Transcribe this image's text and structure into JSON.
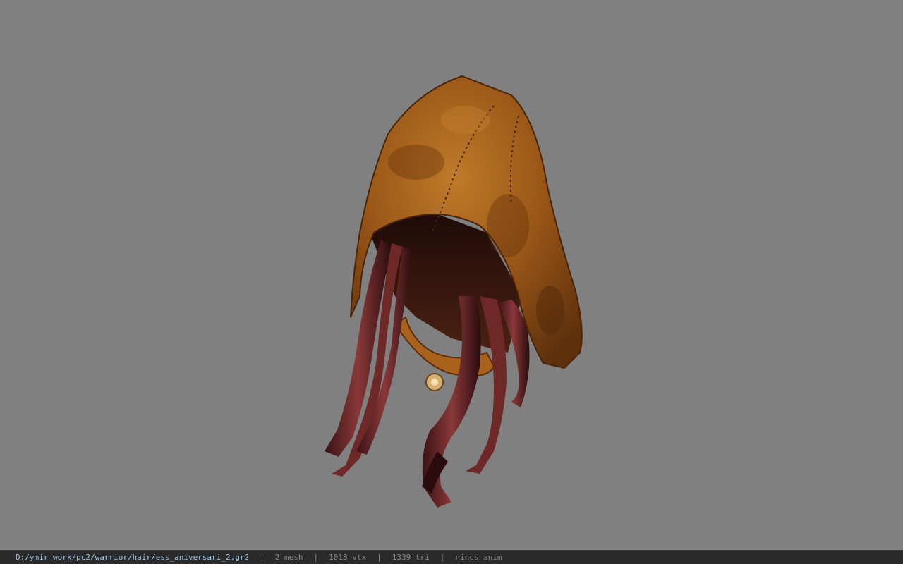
{
  "status_bar": {
    "file_path": "D:/ymir work/pc2/warrior/hair/ess_aniversari_2.gr2",
    "separator": "|",
    "mesh_count": "2 mesh",
    "vertex_count": "1018 vtx",
    "triangle_count": "1339 tri",
    "animation": "nincs anim"
  },
  "colors": {
    "background": "#808080",
    "statusbar": "#2a2a2a",
    "path_text": "#9fc6e6",
    "info_text": "#8a8a8a",
    "hood_leather": "#a8621c",
    "hair": "#7a2e2e"
  }
}
